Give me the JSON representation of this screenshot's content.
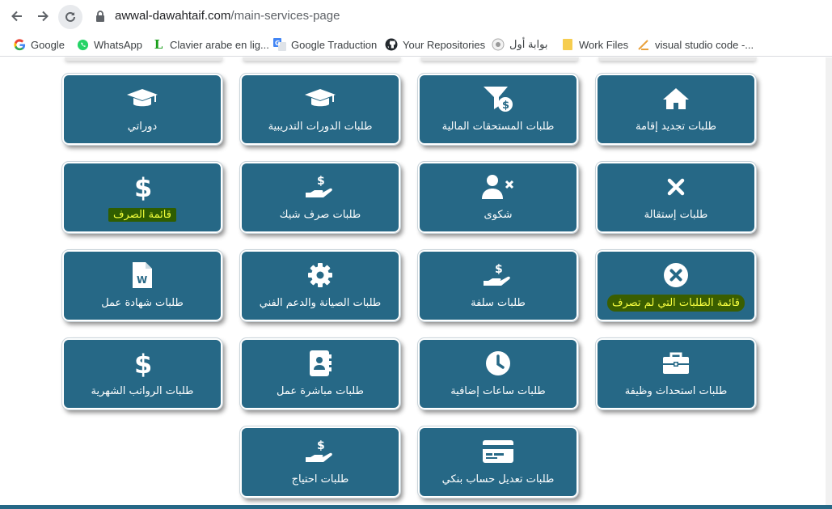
{
  "browser": {
    "url_domain": "awwal-dawahtaif.com",
    "url_path": "/main-services-page",
    "bookmarks": [
      {
        "label": "Google",
        "icon": "google-icon"
      },
      {
        "label": "WhatsApp",
        "icon": "whatsapp-icon"
      },
      {
        "label": "Clavier arabe en lig...",
        "icon": "clavier-icon"
      },
      {
        "label": "Google Traduction",
        "icon": "translate-icon"
      },
      {
        "label": "Your Repositories",
        "icon": "github-icon"
      },
      {
        "label": "بوابة أول",
        "icon": "portal-icon"
      },
      {
        "label": "Work Files",
        "icon": "folder-icon"
      },
      {
        "label": "visual studio code -...",
        "icon": "vscode-icon"
      }
    ]
  },
  "colors": {
    "card_bg": "#266886",
    "highlight_bg": "#2f5d00",
    "highlight_text": "#f3ff3a"
  },
  "cards": [
    {
      "label": "طلبات تجديد إقامة",
      "icon": "home-icon"
    },
    {
      "label": "طلبات المستحقات المالية",
      "icon": "funnel-dollar-icon"
    },
    {
      "label": "طلبات الدورات التدريبية",
      "icon": "graduation-cap-icon"
    },
    {
      "label": "دوراتي",
      "icon": "graduation-cap-icon"
    },
    {
      "label": "طلبات إستقالة",
      "icon": "x-icon"
    },
    {
      "label": "شكوى",
      "icon": "user-x-icon"
    },
    {
      "label": "طلبات صرف شيك",
      "icon": "hand-dollar-icon"
    },
    {
      "label": "قائمة الصرف",
      "icon": "dollar-icon"
    },
    {
      "label": "قائمة الطلبات التي لم تصرف",
      "icon": "circle-x-icon"
    },
    {
      "label": "طلبات سلفة",
      "icon": "hand-dollar-icon"
    },
    {
      "label": "طلبات الصيانة والدعم الفني",
      "icon": "gear-icon"
    },
    {
      "label": "طلبات شهادة عمل",
      "icon": "word-file-icon"
    },
    {
      "label": "طلبات استحداث وظيفة",
      "icon": "briefcase-icon"
    },
    {
      "label": "طلبات ساعات إضافية",
      "icon": "clock-icon"
    },
    {
      "label": "طلبات مباشرة عمل",
      "icon": "address-book-icon"
    },
    {
      "label": "طلبات الرواتب الشهرية",
      "icon": "dollar-icon"
    },
    {
      "label": "طلبات تعديل حساب بنكي",
      "icon": "credit-card-icon"
    },
    {
      "label": "طلبات احتياج",
      "icon": "hand-dollar-icon"
    }
  ]
}
